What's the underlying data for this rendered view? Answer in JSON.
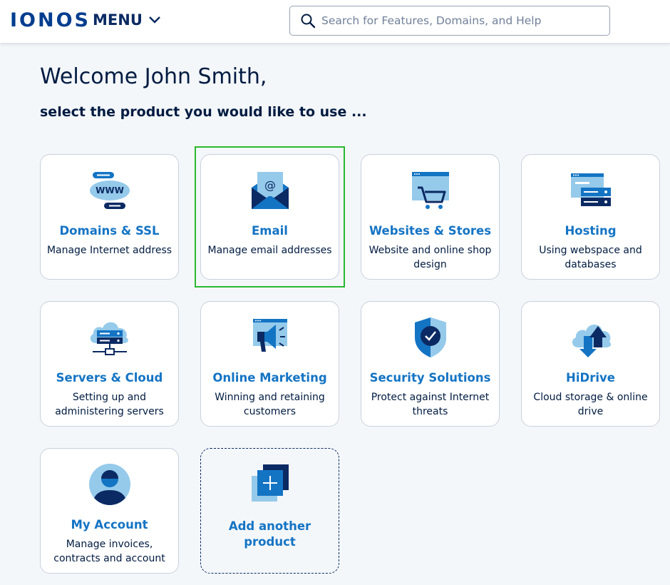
{
  "header": {
    "logo": "IONOS",
    "menu_label": "MENU",
    "search_placeholder": "Search for Features, Domains, and Help"
  },
  "main": {
    "welcome": "Welcome John Smith,",
    "subtitle": "select the product you would like to use ..."
  },
  "cards": [
    {
      "title": "Domains & SSL",
      "desc": "Manage Internet address",
      "icon": "domain-www-icon"
    },
    {
      "title": "Email",
      "desc": "Manage email addresses",
      "icon": "email-envelope-icon"
    },
    {
      "title": "Websites & Stores",
      "desc": "Website and online shop design",
      "icon": "website-cart-icon"
    },
    {
      "title": "Hosting",
      "desc": "Using webspace and databases",
      "icon": "hosting-server-icon"
    },
    {
      "title": "Servers & Cloud",
      "desc": "Setting up and administering servers",
      "icon": "cloud-server-icon"
    },
    {
      "title": "Online Marketing",
      "desc": "Winning and retaining customers",
      "icon": "megaphone-icon"
    },
    {
      "title": "Security Solutions",
      "desc": "Protect against Internet threats",
      "icon": "shield-check-icon"
    },
    {
      "title": "HiDrive",
      "desc": "Cloud storage & online drive",
      "icon": "cloud-upload-icon"
    },
    {
      "title": "My Account",
      "desc": "Manage invoices, contracts and account",
      "icon": "user-avatar-icon"
    },
    {
      "title": "Add another product",
      "desc": "",
      "icon": "add-square-icon"
    }
  ],
  "colors": {
    "brand": "#003d8f",
    "link_blue": "#1474c4",
    "light_blue": "#95caeb",
    "dark_navy": "#0b2a63",
    "highlight_green": "#2ab830"
  }
}
